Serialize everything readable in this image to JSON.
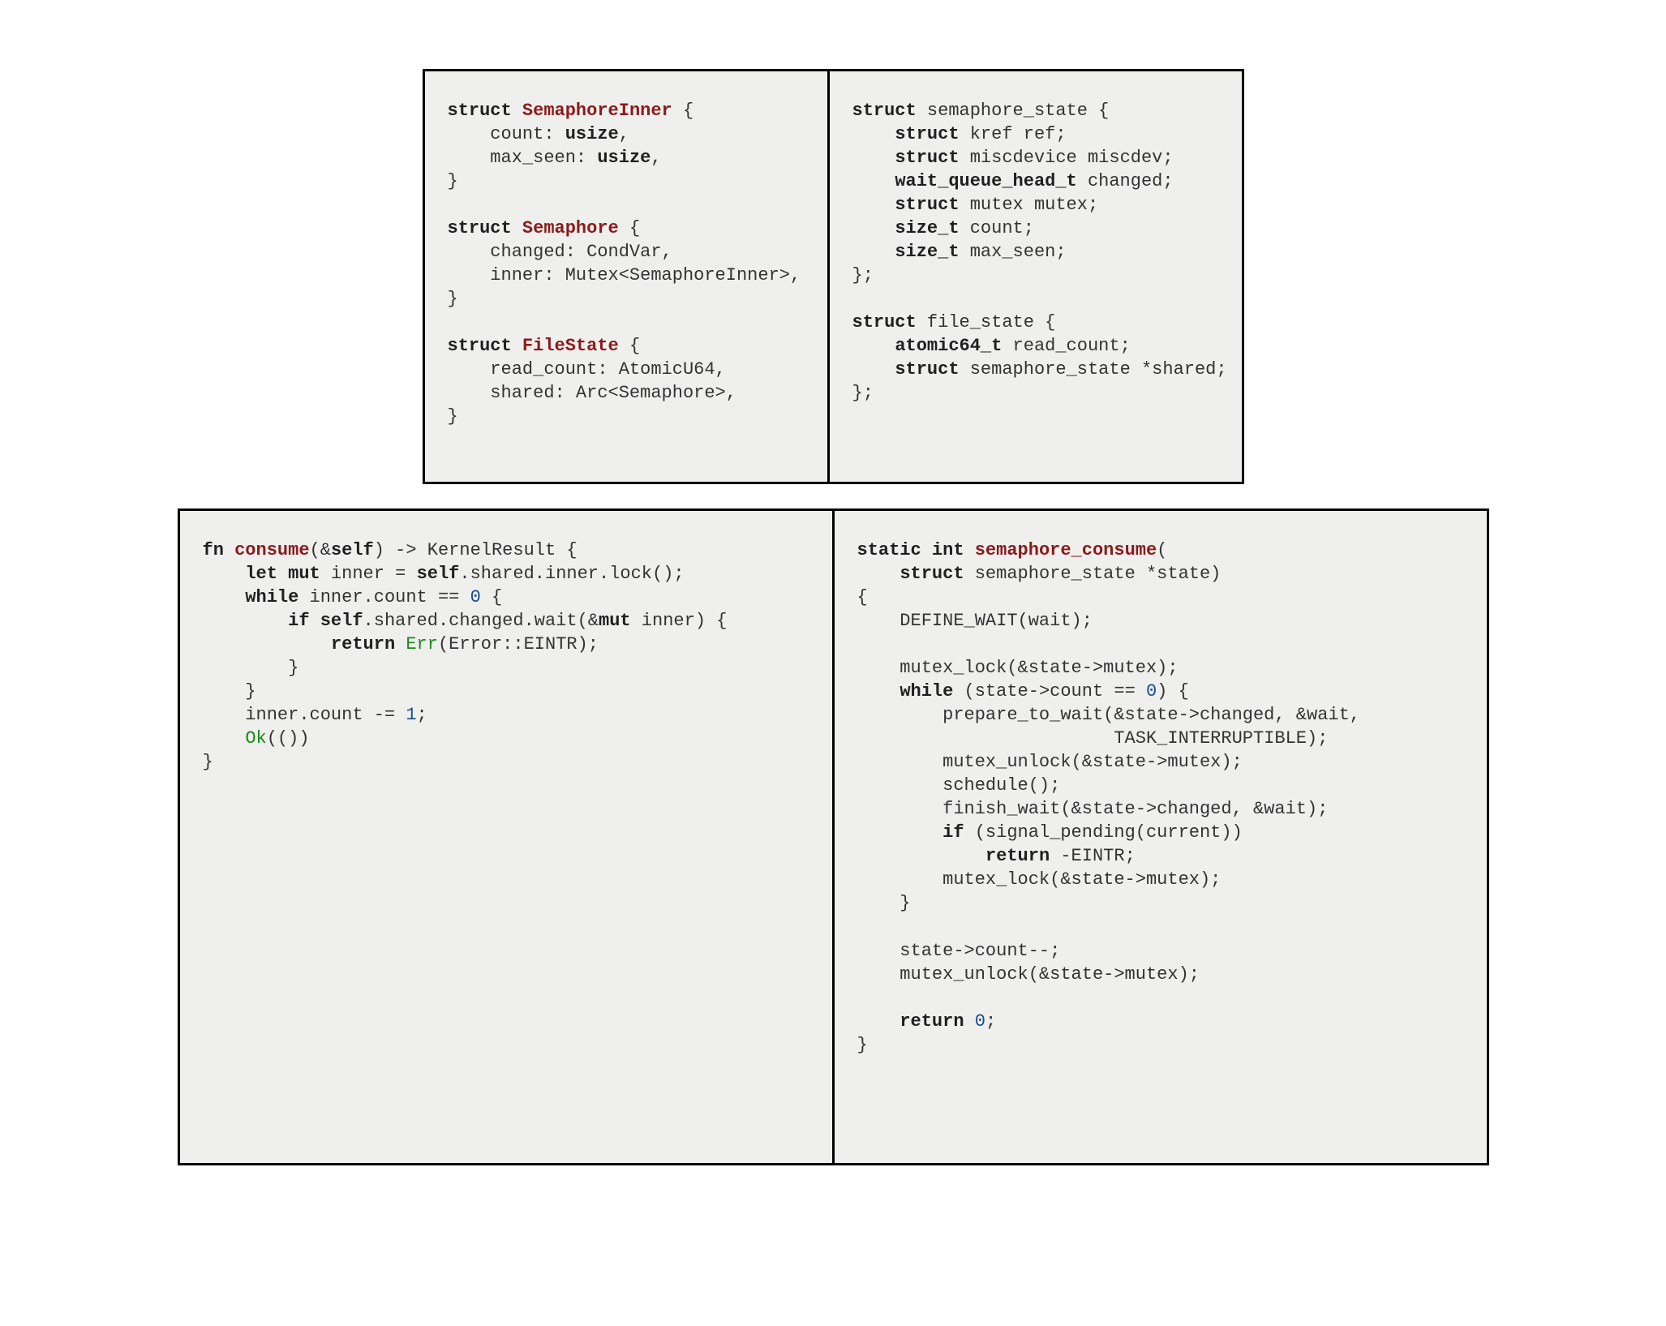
{
  "top_left": {
    "lines": [
      [
        [
          "kw",
          "struct"
        ],
        [
          "pl",
          " "
        ],
        [
          "ty",
          "SemaphoreInner"
        ],
        [
          "pl",
          " {"
        ]
      ],
      [
        [
          "pl",
          "    count: "
        ],
        [
          "kw",
          "usize"
        ],
        [
          "pl",
          ","
        ]
      ],
      [
        [
          "pl",
          "    max_seen: "
        ],
        [
          "kw",
          "usize"
        ],
        [
          "pl",
          ","
        ]
      ],
      [
        [
          "pl",
          "}"
        ]
      ],
      [
        [
          "pl",
          ""
        ]
      ],
      [
        [
          "kw",
          "struct"
        ],
        [
          "pl",
          " "
        ],
        [
          "ty",
          "Semaphore"
        ],
        [
          "pl",
          " {"
        ]
      ],
      [
        [
          "pl",
          "    changed: CondVar,"
        ]
      ],
      [
        [
          "pl",
          "    inner: Mutex<SemaphoreInner>,"
        ]
      ],
      [
        [
          "pl",
          "}"
        ]
      ],
      [
        [
          "pl",
          ""
        ]
      ],
      [
        [
          "kw",
          "struct"
        ],
        [
          "pl",
          " "
        ],
        [
          "ty",
          "FileState"
        ],
        [
          "pl",
          " {"
        ]
      ],
      [
        [
          "pl",
          "    read_count: AtomicU64,"
        ]
      ],
      [
        [
          "pl",
          "    shared: Arc<Semaphore>,"
        ]
      ],
      [
        [
          "pl",
          "}"
        ]
      ]
    ]
  },
  "top_right": {
    "lines": [
      [
        [
          "kw",
          "struct"
        ],
        [
          "pl",
          " semaphore_state {"
        ]
      ],
      [
        [
          "pl",
          "    "
        ],
        [
          "kw",
          "struct"
        ],
        [
          "pl",
          " kref ref;"
        ]
      ],
      [
        [
          "pl",
          "    "
        ],
        [
          "kw",
          "struct"
        ],
        [
          "pl",
          " miscdevice miscdev;"
        ]
      ],
      [
        [
          "pl",
          "    "
        ],
        [
          "kw",
          "wait_queue_head_t"
        ],
        [
          "pl",
          " changed;"
        ]
      ],
      [
        [
          "pl",
          "    "
        ],
        [
          "kw",
          "struct"
        ],
        [
          "pl",
          " mutex mutex;"
        ]
      ],
      [
        [
          "pl",
          "    "
        ],
        [
          "kw",
          "size_t"
        ],
        [
          "pl",
          " count;"
        ]
      ],
      [
        [
          "pl",
          "    "
        ],
        [
          "kw",
          "size_t"
        ],
        [
          "pl",
          " max_seen;"
        ]
      ],
      [
        [
          "pl",
          "};"
        ]
      ],
      [
        [
          "pl",
          ""
        ]
      ],
      [
        [
          "kw",
          "struct"
        ],
        [
          "pl",
          " file_state {"
        ]
      ],
      [
        [
          "pl",
          "    "
        ],
        [
          "kw",
          "atomic64_t"
        ],
        [
          "pl",
          " read_count;"
        ]
      ],
      [
        [
          "pl",
          "    "
        ],
        [
          "kw",
          "struct"
        ],
        [
          "pl",
          " semaphore_state *shared;"
        ]
      ],
      [
        [
          "pl",
          "};"
        ]
      ]
    ]
  },
  "bottom_left": {
    "lines": [
      [
        [
          "kw",
          "fn"
        ],
        [
          "pl",
          " "
        ],
        [
          "ty",
          "consume"
        ],
        [
          "pl",
          "(&"
        ],
        [
          "kw",
          "self"
        ],
        [
          "pl",
          ") -> KernelResult {"
        ]
      ],
      [
        [
          "pl",
          "    "
        ],
        [
          "kw",
          "let mut"
        ],
        [
          "pl",
          " inner = "
        ],
        [
          "kw",
          "self"
        ],
        [
          "pl",
          ".shared.inner.lock();"
        ]
      ],
      [
        [
          "pl",
          "    "
        ],
        [
          "kw",
          "while"
        ],
        [
          "pl",
          " inner.count == "
        ],
        [
          "num",
          "0"
        ],
        [
          "pl",
          " {"
        ]
      ],
      [
        [
          "pl",
          "        "
        ],
        [
          "kw",
          "if self"
        ],
        [
          "pl",
          ".shared.changed.wait(&"
        ],
        [
          "kw",
          "mut"
        ],
        [
          "pl",
          " inner) {"
        ]
      ],
      [
        [
          "pl",
          "            "
        ],
        [
          "kw",
          "return"
        ],
        [
          "pl",
          " "
        ],
        [
          "err",
          "Err"
        ],
        [
          "pl",
          "(Error::EINTR);"
        ]
      ],
      [
        [
          "pl",
          "        }"
        ]
      ],
      [
        [
          "pl",
          "    }"
        ]
      ],
      [
        [
          "pl",
          "    inner.count -= "
        ],
        [
          "num",
          "1"
        ],
        [
          "pl",
          ";"
        ]
      ],
      [
        [
          "pl",
          "    "
        ],
        [
          "ok",
          "Ok"
        ],
        [
          "pl",
          "(())"
        ]
      ],
      [
        [
          "pl",
          "}"
        ]
      ]
    ]
  },
  "bottom_right": {
    "lines": [
      [
        [
          "kw",
          "static int"
        ],
        [
          "pl",
          " "
        ],
        [
          "ty",
          "semaphore_consume"
        ],
        [
          "pl",
          "("
        ]
      ],
      [
        [
          "pl",
          "    "
        ],
        [
          "kw",
          "struct"
        ],
        [
          "pl",
          " semaphore_state *state)"
        ]
      ],
      [
        [
          "pl",
          "{"
        ]
      ],
      [
        [
          "pl",
          "    DEFINE_WAIT(wait);"
        ]
      ],
      [
        [
          "pl",
          ""
        ]
      ],
      [
        [
          "pl",
          "    mutex_lock(&state->mutex);"
        ]
      ],
      [
        [
          "pl",
          "    "
        ],
        [
          "kw",
          "while"
        ],
        [
          "pl",
          " (state->count == "
        ],
        [
          "num",
          "0"
        ],
        [
          "pl",
          ") {"
        ]
      ],
      [
        [
          "pl",
          "        prepare_to_wait(&state->changed, &wait,"
        ]
      ],
      [
        [
          "pl",
          "                        TASK_INTERRUPTIBLE);"
        ]
      ],
      [
        [
          "pl",
          "        mutex_unlock(&state->mutex);"
        ]
      ],
      [
        [
          "pl",
          "        schedule();"
        ]
      ],
      [
        [
          "pl",
          "        finish_wait(&state->changed, &wait);"
        ]
      ],
      [
        [
          "pl",
          "        "
        ],
        [
          "kw",
          "if"
        ],
        [
          "pl",
          " (signal_pending(current))"
        ]
      ],
      [
        [
          "pl",
          "            "
        ],
        [
          "kw",
          "return"
        ],
        [
          "pl",
          " -EINTR;"
        ]
      ],
      [
        [
          "pl",
          "        mutex_lock(&state->mutex);"
        ]
      ],
      [
        [
          "pl",
          "    }"
        ]
      ],
      [
        [
          "pl",
          ""
        ]
      ],
      [
        [
          "pl",
          "    state->count--;"
        ]
      ],
      [
        [
          "pl",
          "    mutex_unlock(&state->mutex);"
        ]
      ],
      [
        [
          "pl",
          ""
        ]
      ],
      [
        [
          "pl",
          "    "
        ],
        [
          "kw",
          "return"
        ],
        [
          "pl",
          " "
        ],
        [
          "num",
          "0"
        ],
        [
          "pl",
          ";"
        ]
      ],
      [
        [
          "pl",
          "}"
        ]
      ]
    ]
  }
}
